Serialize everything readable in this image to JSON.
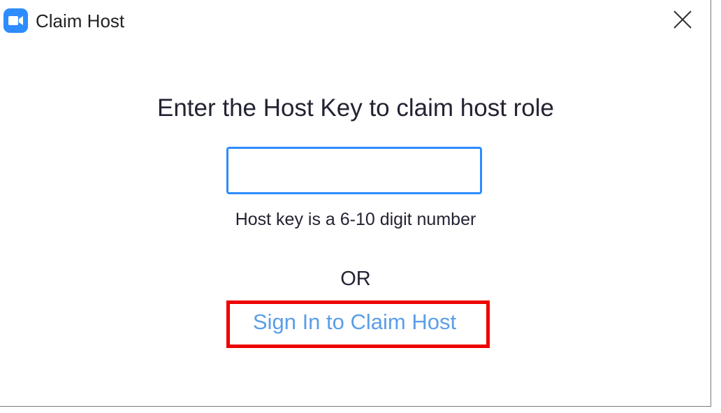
{
  "window": {
    "title": "Claim Host",
    "app_icon": "zoom-camera-icon",
    "close_icon": "close-icon"
  },
  "main": {
    "heading": "Enter the Host Key to claim host role",
    "host_key_input": {
      "value": "",
      "placeholder": ""
    },
    "hint": "Host key is a 6-10 digit number",
    "or_text": "OR",
    "sign_in_link": "Sign In to Claim Host"
  },
  "colors": {
    "accent": "#2d8cff",
    "link": "#5b9ee8",
    "highlight": "#ee0000"
  }
}
